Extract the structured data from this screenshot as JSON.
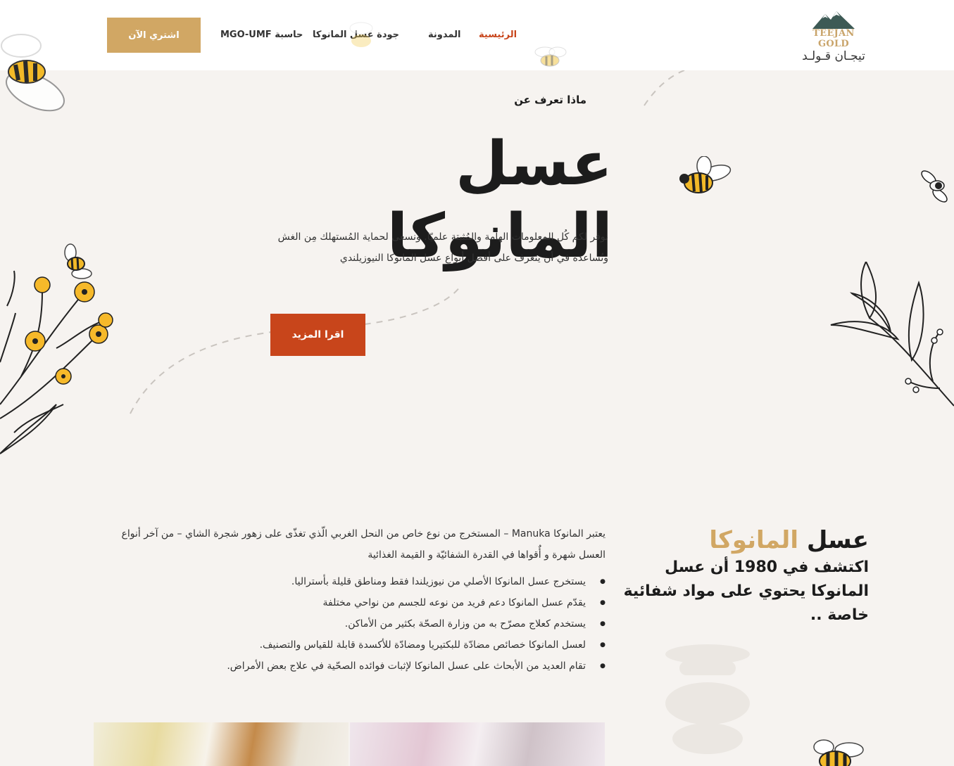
{
  "brand": {
    "name_en": "TEEJAN GOLD",
    "name_ar": "تيجـان قـولـد",
    "accent_color": "#d1a764",
    "primary_color": "#c8451b"
  },
  "nav": {
    "home": "الرئيسية",
    "blog": "المدونة",
    "quality": "جودة عسل المانوكا",
    "calculator": "حاسبة MGO-UMF",
    "buy_button": "اشتري الآن"
  },
  "hero": {
    "pre_title": "ماذا تعرف عن",
    "title": "عسل المانوكا",
    "description": "نوفر لكم كُل المعلومات الهامة والمُثبتة علميًا. ونسعى لحماية المُستهلك مِن الغش ونُساعده في أن يتعرف على أفضل أنواع عسل المانوكا النيوزيلندي",
    "button": "اقرا المزيد"
  },
  "about": {
    "title_part1": "عسل",
    "title_part2": "المانوكا",
    "subtitle": "اكتشف في 1980 أن عسل المانوكا يحتوي على مواد شفائية خاصة ..",
    "intro": "يعتبر  المانوكا Manuka – المستخرج من نوع خاص من النحل الغربي الّذي تغذّى على زهور شجرة الشاي – من آخر أنواع العسل شهرة و أٌقواها في القدرة الشفائيّة و القيمة الغذائية",
    "bullets": [
      "يستخرج عسل المانوكا الأصلي من نيوزيلندا فقط ومناطق قليلة بأستراليا.",
      "يقدّم عسل المانوكا دعم فريد من نوعه للجسم من نواحي مختلفة",
      "يستخدم كعلاج مصرّح به من وزارة الصحّة بكثير من الأماكن.",
      "لعسل المانوكا خصائص مضادّة للبكتيريا ومضادّة للأكسدة قابلة للقياس والتصنيف.",
      "تقام العديد من الأبحاث على عسل المانوكا لإثبات فوائده الصحّية في علاج بعض الأمراض."
    ]
  }
}
